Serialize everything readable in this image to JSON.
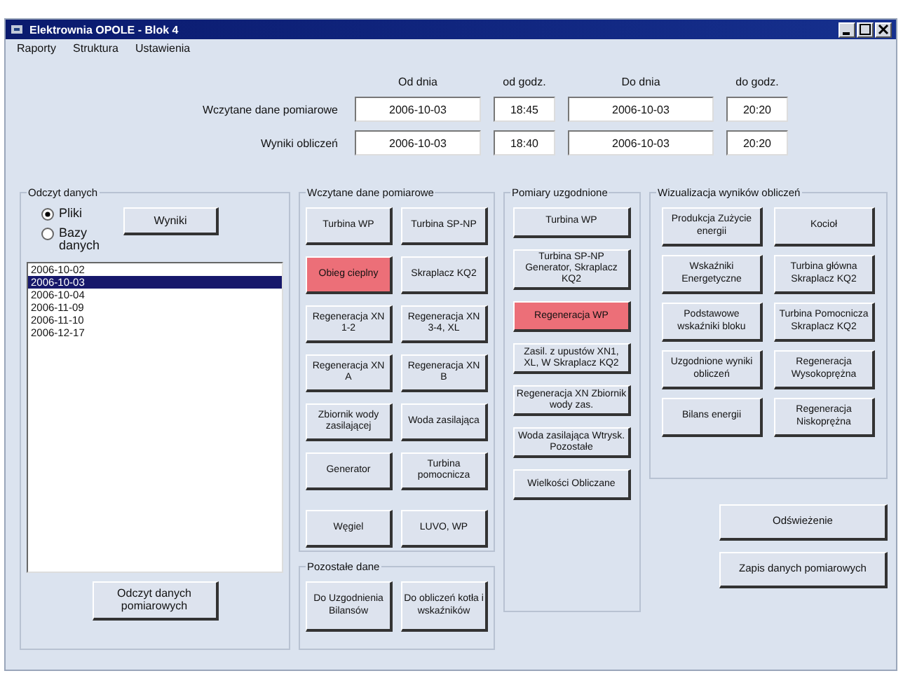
{
  "window": {
    "title": "Elektrownia OPOLE - Blok 4"
  },
  "menu": [
    "Raporty",
    "Struktura",
    "Ustawienia"
  ],
  "range": {
    "headers": [
      "Od dnia",
      "od godz.",
      "Do dnia",
      "do godz."
    ],
    "rows": [
      {
        "label": "Wczytane dane pomiarowe",
        "values": [
          "2006-10-03",
          "18:45",
          "2006-10-03",
          "20:20"
        ]
      },
      {
        "label": "Wyniki obliczeń",
        "values": [
          "2006-10-03",
          "18:40",
          "2006-10-03",
          "20:20"
        ]
      }
    ]
  },
  "read": {
    "title": "Odczyt danych",
    "options": [
      {
        "label": "Pliki",
        "selected": true
      },
      {
        "label": "Bazy danych",
        "selected": false
      }
    ],
    "results_button": "Wyniki",
    "dates": [
      {
        "label": "2006-10-02",
        "selected": false
      },
      {
        "label": "2006-10-03",
        "selected": true
      },
      {
        "label": "2006-10-04",
        "selected": false
      },
      {
        "label": "2006-11-09",
        "selected": false
      },
      {
        "label": "2006-11-10",
        "selected": false
      },
      {
        "label": "2006-12-17",
        "selected": false
      }
    ],
    "read_button": "Odczyt danych pomiarowych"
  },
  "measured": {
    "title": "Wczytane dane pomiarowe",
    "rows": [
      [
        {
          "label": "Turbina WP",
          "highlighted": false
        },
        {
          "label": "Turbina SP-NP",
          "highlighted": false
        }
      ],
      [
        {
          "label": "Obieg cieplny",
          "highlighted": true
        },
        {
          "label": "Skraplacz KQ2",
          "highlighted": false
        }
      ],
      [
        {
          "label": "Regeneracja XN 1-2",
          "highlighted": false
        },
        {
          "label": "Regeneracja XN 3-4, XL",
          "highlighted": false
        }
      ],
      [
        {
          "label": "Regeneracja XN A",
          "highlighted": false
        },
        {
          "label": "Regeneracja XN B",
          "highlighted": false
        }
      ],
      [
        {
          "label": "Zbiornik wody zasilającej",
          "highlighted": false
        },
        {
          "label": "Woda zasilająca",
          "highlighted": false
        }
      ],
      [
        {
          "label": "Generator",
          "highlighted": false
        },
        {
          "label": "Turbina pomocnicza",
          "highlighted": false
        }
      ]
    ],
    "bottom_row": [
      {
        "label": "Węgiel",
        "highlighted": false
      },
      {
        "label": "LUVO, WP",
        "highlighted": false
      }
    ]
  },
  "other": {
    "title": "Pozostałe dane",
    "buttons": [
      {
        "label": "Do Uzgodnienia Bilansów",
        "highlighted": false
      },
      {
        "label": "Do obliczeń kotła i wskaźników",
        "highlighted": false
      }
    ]
  },
  "reconciled": {
    "title": "Pomiary uzgodnione",
    "buttons": [
      {
        "label": "Turbina WP",
        "highlighted": false
      },
      {
        "label": "Turbina SP-NP Generator, Skraplacz KQ2",
        "highlighted": false
      },
      {
        "label": "Regeneracja WP",
        "highlighted": true
      },
      {
        "label": "Zasil. z upustów XN1, XL, W Skraplacz KQ2",
        "highlighted": false
      },
      {
        "label": "Regeneracja XN Zbiornik wody zas.",
        "highlighted": false
      },
      {
        "label": "Woda zasilająca Wtrysk. Pozostałe",
        "highlighted": false
      },
      {
        "label": "Wielkości Obliczane",
        "highlighted": false
      }
    ]
  },
  "visual": {
    "title": "Wizualizacja wyników obliczeń",
    "buttons": [
      {
        "label": "Produkcja Zużycie energii",
        "highlighted": false
      },
      {
        "label": "Kocioł",
        "highlighted": false
      },
      {
        "label": "Wskaźniki Energetyczne",
        "highlighted": false
      },
      {
        "label": "Turbina główna Skraplacz KQ2",
        "highlighted": false
      },
      {
        "label": "Podstawowe wskaźniki bloku",
        "highlighted": false
      },
      {
        "label": "Turbina Pomocnicza Skraplacz KQ2",
        "highlighted": false
      },
      {
        "label": "Uzgodnione wyniki obliczeń",
        "highlighted": false
      },
      {
        "label": "Regeneracja Wysokoprężna",
        "highlighted": false
      },
      {
        "label": "Bilans energii",
        "highlighted": false
      },
      {
        "label": "Regeneracja Niskoprężna",
        "highlighted": false
      }
    ]
  },
  "actions": [
    "Odświeżenie",
    "Zapis danych pomiarowych"
  ]
}
